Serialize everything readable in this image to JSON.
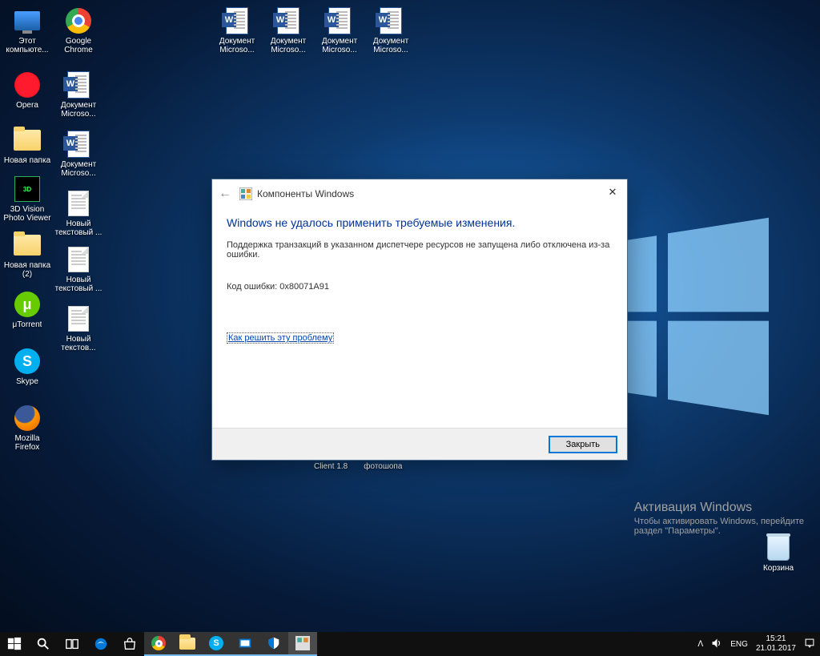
{
  "desktop": {
    "icons_col1": [
      {
        "label": "Этот компьюте...",
        "kind": "monitor"
      },
      {
        "label": "Opera",
        "kind": "opera"
      },
      {
        "label": "Новая папка",
        "kind": "folder"
      },
      {
        "label": "3D Vision Photo Viewer",
        "kind": "3d"
      },
      {
        "label": "Новая папка (2)",
        "kind": "folder"
      },
      {
        "label": "μTorrent",
        "kind": "ut"
      },
      {
        "label": "Skype",
        "kind": "skype"
      },
      {
        "label": "Mozilla Firefox",
        "kind": "ff"
      }
    ],
    "icons_col2": [
      {
        "label": "Google Chrome",
        "kind": "chrome"
      },
      {
        "label": "Документ Microso...",
        "kind": "word"
      },
      {
        "label": "Документ Microso...",
        "kind": "word"
      },
      {
        "label": "Новый текстовый ...",
        "kind": "txt"
      },
      {
        "label": "Новый текстовый ...",
        "kind": "txt"
      },
      {
        "label": "Новый текстов...",
        "kind": "txt"
      }
    ],
    "icons_row_top": [
      {
        "label": "Документ Microso...",
        "kind": "word"
      },
      {
        "label": "Документ Microso...",
        "kind": "word"
      },
      {
        "label": "Документ Microso...",
        "kind": "word"
      },
      {
        "label": "Документ Microso...",
        "kind": "word"
      }
    ],
    "hidden_labels": [
      "Client 1.8",
      "фотошопа"
    ],
    "recycle_bin": "Корзина"
  },
  "dialog": {
    "title": "Компоненты Windows",
    "heading": "Windows не удалось применить требуемые изменения.",
    "text": "Поддержка транзакций в указанном диспетчере ресурсов не запущена либо отключена из-за ошибки.",
    "code_label": "Код ошибки: 0x80071A91",
    "link": "Как решить эту проблему",
    "close_button": "Закрыть"
  },
  "activation": {
    "title": "Активация Windows",
    "sub1": "Чтобы активировать Windows, перейдите",
    "sub2": "раздел \"Параметры\"."
  },
  "tray": {
    "lang": "ENG",
    "time": "15:21",
    "date": "21.01.2017"
  }
}
